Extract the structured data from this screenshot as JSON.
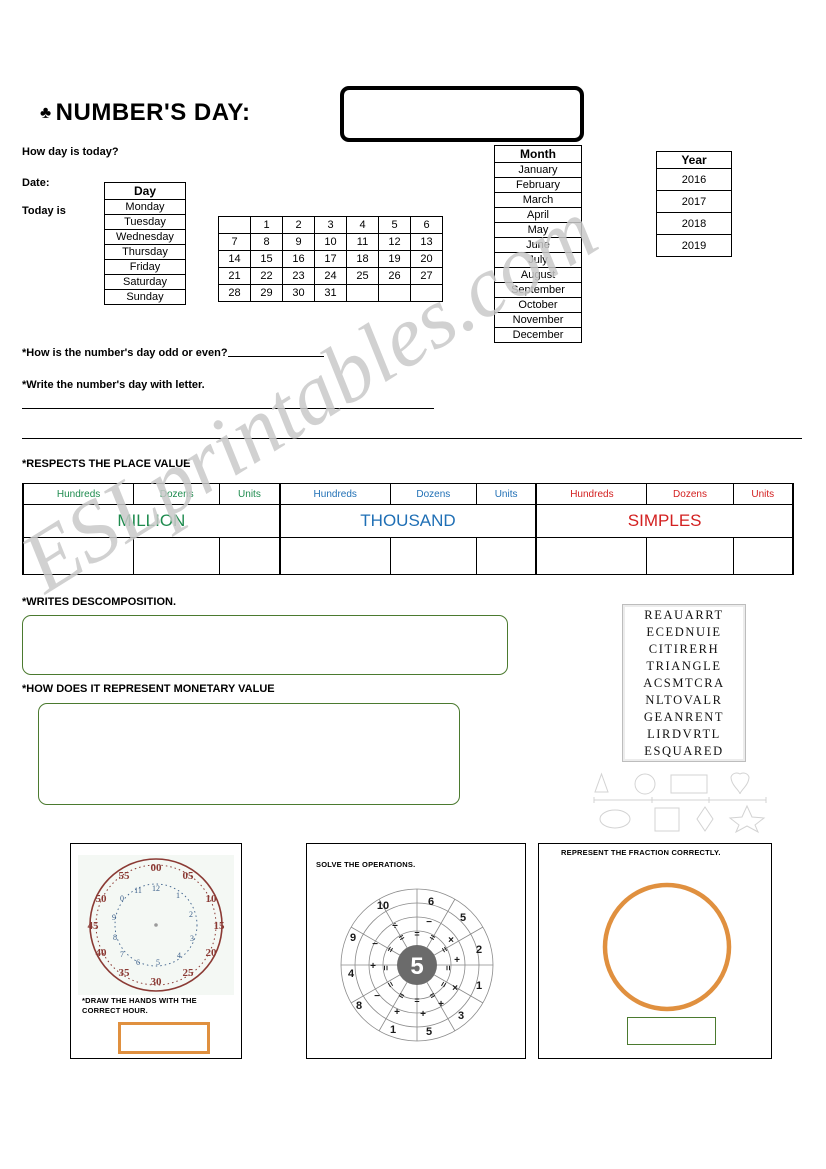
{
  "header": {
    "club_icon": "♣",
    "title": "NUMBER'S DAY:",
    "answer_box_value": ""
  },
  "intro": {
    "how_day": "How day is today?",
    "date_label": "Date:",
    "today_is_label": "Today is"
  },
  "day_table": {
    "header": "Day",
    "rows": [
      "Monday",
      "Tuesday",
      "Wednesday",
      "Thursday",
      "Friday",
      "Saturday",
      "Sunday"
    ]
  },
  "calendar": {
    "rows": [
      [
        "",
        "1",
        "2",
        "3",
        "4",
        "5",
        "6"
      ],
      [
        "7",
        "8",
        "9",
        "10",
        "11",
        "12",
        "13"
      ],
      [
        "14",
        "15",
        "16",
        "17",
        "18",
        "19",
        "20"
      ],
      [
        "21",
        "22",
        "23",
        "24",
        "25",
        "26",
        "27"
      ],
      [
        "28",
        "29",
        "30",
        "31",
        "",
        "",
        ""
      ]
    ]
  },
  "month_table": {
    "header": "Month",
    "rows": [
      "January",
      "February",
      "March",
      "April",
      "May",
      "June",
      "July",
      "August",
      "September",
      "October",
      "November",
      "December"
    ]
  },
  "year_table": {
    "header": "Year",
    "rows": [
      "2016",
      "2017",
      "2018",
      "2019"
    ]
  },
  "questions": {
    "odd_or_even": "*How is the number's day odd or even?",
    "write_with_letter": "*Write the number's day with letter.",
    "place_value": "*RESPECTS THE PLACE VALUE",
    "decomposition": "*WRITES DESCOMPOSITION.",
    "monetary": "*HOW DOES IT REPRESENT  MONETARY VALUE"
  },
  "place_value": {
    "column_labels": [
      "Hundreds",
      "Dozens",
      "Units",
      "Hundreds",
      "Dozens",
      "Units",
      "Hundreds",
      "Dozens",
      "Units"
    ],
    "groups": [
      "MILLION",
      "THOUSAND",
      "SIMPLES"
    ],
    "group_colors": [
      "#1e8b4e",
      "#1f6fb5",
      "#d32020"
    ],
    "answer_cells": [
      "",
      "",
      "",
      "",
      "",
      "",
      "",
      "",
      ""
    ]
  },
  "answer_boxes": {
    "decomposition_value": "",
    "monetary_value": "",
    "clock_value": "",
    "fraction_value": ""
  },
  "word_search": {
    "rows": [
      "REAUARRT",
      "ECEDNUIE",
      "CITIRERH",
      "TRIANGLE",
      "ACSMTCRA",
      "NLTOVALR",
      "GEANRENT",
      "LIRDVRTL",
      "ESQUARED"
    ]
  },
  "shapes": {
    "row1": [
      "triangle",
      "circle",
      "rectangle",
      "heart"
    ],
    "row2": [
      "ellipse",
      "square",
      "diamond",
      "star"
    ]
  },
  "clock": {
    "caption": "*DRAW THE HANDS WITH THE CORRECT HOUR.",
    "minute_marks": [
      "00",
      "05",
      "10",
      "15",
      "20",
      "25",
      "30",
      "35",
      "40",
      "45",
      "50",
      "55"
    ],
    "hour_marks": [
      "12",
      "1",
      "2",
      "3",
      "4",
      "5",
      "6",
      "7",
      "8",
      "9",
      "0",
      "11"
    ],
    "outer_color": "#8b3a34",
    "inner_color": "#3b5f8a"
  },
  "operations": {
    "caption": "SOLVE THE OPERATIONS.",
    "center_value": "5",
    "sectors": [
      {
        "operator": "−",
        "number": "6"
      },
      {
        "operator": "×",
        "number": "5"
      },
      {
        "operator": "+",
        "number": "2"
      },
      {
        "operator": "×",
        "number": "1"
      },
      {
        "operator": "+",
        "number": "3"
      },
      {
        "operator": "+",
        "number": "5"
      },
      {
        "operator": "+",
        "number": "1"
      },
      {
        "operator": "−",
        "number": "8"
      },
      {
        "operator": "+",
        "number": "4"
      },
      {
        "operator": "−",
        "number": "9"
      },
      {
        "operator": "÷",
        "number": "10"
      }
    ],
    "equals_symbol": "="
  },
  "fraction": {
    "caption": "REPRESENT THE FRACTION CORRECTLY.",
    "circle_color": "#e0903f",
    "box_color": "#4b7a2f"
  },
  "watermark": {
    "text": "ESLprintables.com"
  }
}
